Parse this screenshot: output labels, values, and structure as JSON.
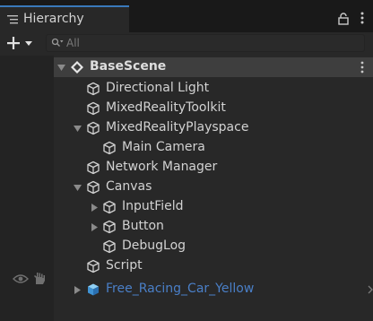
{
  "panel": {
    "tab_label": "Hierarchy",
    "search_placeholder": "All"
  },
  "colors": {
    "accent": "#3a79bb",
    "prefab": "#4a7fc7",
    "selected_row": "#3e3e3e"
  },
  "tree": {
    "scene_name": "BaseScene",
    "items": [
      {
        "label": "Directional Light",
        "depth": 1
      },
      {
        "label": "MixedRealityToolkit",
        "depth": 1
      },
      {
        "label": "MixedRealityPlayspace",
        "depth": 1,
        "expanded": true
      },
      {
        "label": "Main Camera",
        "depth": 2
      },
      {
        "label": "Network Manager",
        "depth": 1
      },
      {
        "label": "Canvas",
        "depth": 1,
        "expanded": true
      },
      {
        "label": "InputField",
        "depth": 2,
        "collapsed": true
      },
      {
        "label": "Button",
        "depth": 2,
        "collapsed": true
      },
      {
        "label": "DebugLog",
        "depth": 2
      },
      {
        "label": "Script",
        "depth": 1
      },
      {
        "label": "Free_Racing_Car_Yellow",
        "depth": 1,
        "collapsed": true,
        "prefab": true
      }
    ]
  }
}
